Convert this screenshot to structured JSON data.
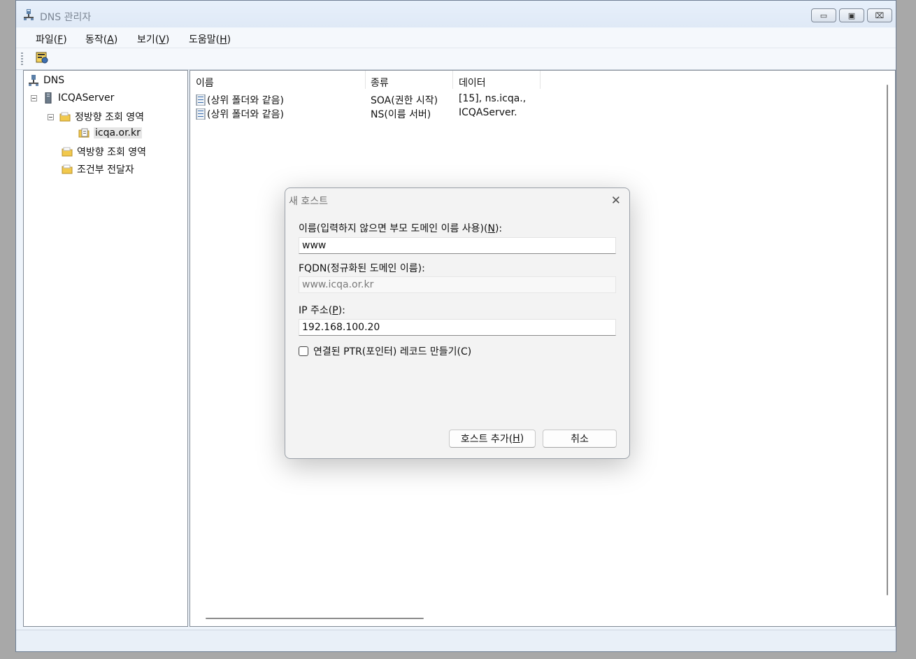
{
  "window": {
    "title": "DNS 관리자",
    "controls": {
      "minimize": "▭",
      "maximize": "▣",
      "close": "⌧"
    }
  },
  "menu": [
    {
      "label": "파일(",
      "key": "F",
      "suffix": ")"
    },
    {
      "label": "동작(",
      "key": "A",
      "suffix": ")"
    },
    {
      "label": "보기(",
      "key": "V",
      "suffix": ")"
    },
    {
      "label": "도움말(",
      "key": "H",
      "suffix": ")"
    }
  ],
  "tree": {
    "root": "DNS",
    "server": "ICQAServer",
    "forward_zones": "정방향 조회 영역",
    "zone": "icqa.or.kr",
    "reverse_zones": "역방향 조회 영역",
    "conditional_forwarders": "조건부 전달자"
  },
  "list": {
    "columns": [
      "이름",
      "종류",
      "데이터"
    ],
    "rows": [
      {
        "name": "(상위 폴더와 같음)",
        "type": "SOA(권한 시작)",
        "data": "[15], ns.icqa.,"
      },
      {
        "name": "(상위 폴더와 같음)",
        "type": "NS(이름 서버)",
        "data": "ICQAServer."
      }
    ]
  },
  "dialog": {
    "title": "새 호스트",
    "name_label_prefix": "이름(입력하지 않으면 부모 도메인 이름 사용)(",
    "name_label_key": "N",
    "name_label_suffix": "):",
    "name_value": "www",
    "fqdn_label": "FQDN(정규화된 도메인 이름):",
    "fqdn_value": "www.icqa.or.kr",
    "ip_label_prefix": "IP 주소(",
    "ip_label_key": "P",
    "ip_label_suffix": "):",
    "ip_value": "192.168.100.20",
    "ptr_label": "연결된 PTR(포인터) 레코드 만들기(C)",
    "ptr_checked": false,
    "add_prefix": "호스트 추가(",
    "add_key": "H",
    "add_suffix": ")",
    "cancel": "취소"
  },
  "icons": {
    "app": "dns-server-icon",
    "toolbar": "properties-icon",
    "folder_color": "#f2c94c",
    "server_color": "#5c6b7a"
  }
}
